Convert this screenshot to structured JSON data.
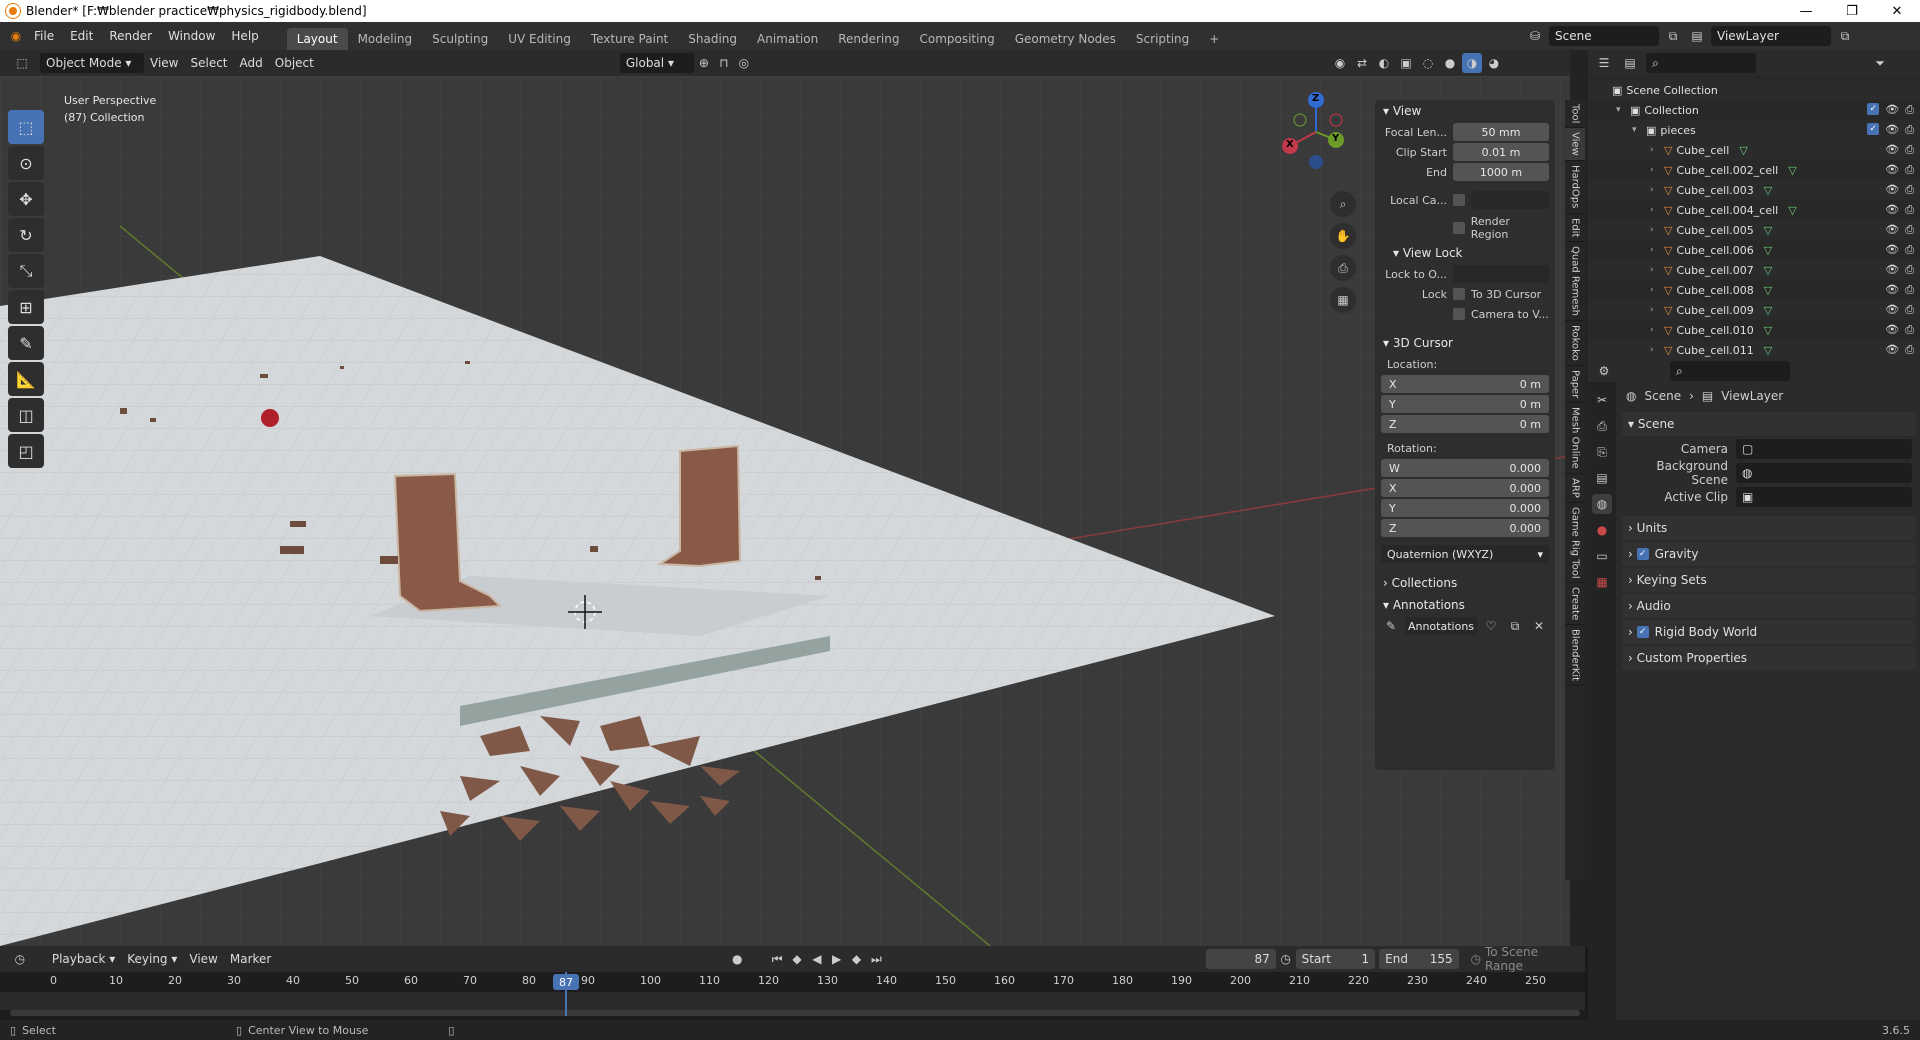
{
  "window": {
    "title": "Blender* [F:₩blender practice₩physics_rigidbody.blend]"
  },
  "menus": [
    "File",
    "Edit",
    "Render",
    "Window",
    "Help"
  ],
  "workspaces": [
    "Layout",
    "Modeling",
    "Sculpting",
    "UV Editing",
    "Texture Paint",
    "Shading",
    "Animation",
    "Rendering",
    "Compositing",
    "Geometry Nodes",
    "Scripting",
    "+"
  ],
  "scene": {
    "label": "Scene",
    "viewlayer": "ViewLayer"
  },
  "viewport_header": {
    "mode": "Object Mode",
    "view": "View",
    "select": "Select",
    "add": "Add",
    "object": "Object",
    "orientation": "Global",
    "options": "Options"
  },
  "viewport_info": {
    "line1": "User Perspective",
    "line2": "(87) Collection"
  },
  "gizmo": {
    "x": "X",
    "y": "Y",
    "z": "Z"
  },
  "npanel": {
    "view_header": "View",
    "focal_label": "Focal Len...",
    "focal_value": "50 mm",
    "clip_start_label": "Clip Start",
    "clip_start_value": "0.01 m",
    "end_label": "End",
    "end_value": "1000 m",
    "local_cam_label": "Local Ca...",
    "render_region": "Render Region",
    "view_lock_header": "View Lock",
    "lock_to_label": "Lock to O...",
    "lock_label": "Lock",
    "to_3d_cursor": "To 3D Cursor",
    "camera_to_view": "Camera to V...",
    "cursor_header": "3D Cursor",
    "location_label": "Location:",
    "loc": [
      {
        "axis": "X",
        "value": "0 m"
      },
      {
        "axis": "Y",
        "value": "0 m"
      },
      {
        "axis": "Z",
        "value": "0 m"
      }
    ],
    "rotation_label": "Rotation:",
    "rot": [
      {
        "axis": "W",
        "value": "0.000"
      },
      {
        "axis": "X",
        "value": "0.000"
      },
      {
        "axis": "Y",
        "value": "0.000"
      },
      {
        "axis": "Z",
        "value": "0.000"
      }
    ],
    "rotation_mode": "Quaternion (WXYZ)",
    "collections": "Collections",
    "annotations_header": "Annotations",
    "annotations_btn": "Annotations"
  },
  "side_tabs": [
    "Tool",
    "View",
    "HardOps",
    "Edit",
    "Quad Remesh",
    "Rokoko",
    "Paper",
    "Mesh Online",
    "ARP",
    "Game Rig Tool",
    "Create",
    "BlenderKit"
  ],
  "outliner": {
    "scene_collection": "Scene Collection",
    "collection": "Collection",
    "pieces": "pieces",
    "items": [
      "Cube_cell",
      "Cube_cell.002_cell",
      "Cube_cell.003",
      "Cube_cell.004_cell",
      "Cube_cell.005",
      "Cube_cell.006",
      "Cube_cell.007",
      "Cube_cell.008",
      "Cube_cell.009",
      "Cube_cell.010",
      "Cube_cell.011"
    ]
  },
  "properties": {
    "breadcrumb_scene": "Scene",
    "breadcrumb_viewlayer": "ViewLayer",
    "scene_section": "Scene",
    "camera_label": "Camera",
    "bg_scene_label": "Background Scene",
    "active_clip_label": "Active Clip",
    "sections": [
      {
        "label": "Units",
        "check": false
      },
      {
        "label": "Gravity",
        "check": true
      },
      {
        "label": "Keying Sets",
        "check": false
      },
      {
        "label": "Audio",
        "check": false
      },
      {
        "label": "Rigid Body World",
        "check": true
      },
      {
        "label": "Custom Properties",
        "check": false
      }
    ]
  },
  "timeline": {
    "playback": "Playback",
    "keying": "Keying",
    "view": "View",
    "marker": "Marker",
    "current_frame": "87",
    "start_label": "Start",
    "start": "1",
    "end_label": "End",
    "end": "155",
    "scene_range": "To Scene Range",
    "ticks": [
      "0",
      "10",
      "20",
      "30",
      "40",
      "50",
      "60",
      "70",
      "80",
      "90",
      "100",
      "110",
      "120",
      "130",
      "140",
      "150",
      "160",
      "170",
      "180",
      "190",
      "200",
      "210",
      "220",
      "230",
      "240",
      "250"
    ],
    "playhead": "87"
  },
  "status": {
    "select": "Select",
    "center": "Center View to Mouse",
    "version": "3.6.5"
  },
  "colors": {
    "accent": "#4772b3",
    "orange": "#e87d0d",
    "viewport_bg": "#3a3a3a"
  }
}
